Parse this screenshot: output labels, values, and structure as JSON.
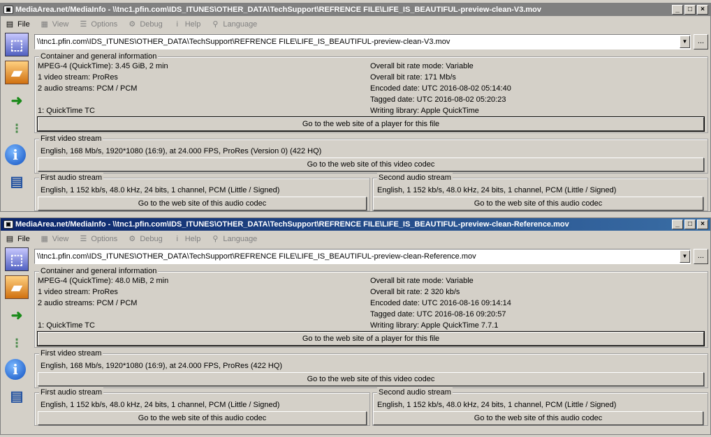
{
  "windows": [
    {
      "title": "MediaArea.net/MediaInfo - \\\\tnc1.pfin.com\\IDS_ITUNES\\OTHER_DATA\\TechSupport\\REFRENCE FILE\\LIFE_IS_BEAUTIFUL-preview-clean-V3.mov",
      "active": false,
      "path": "\\\\tnc1.pfin.com\\IDS_ITUNES\\OTHER_DATA\\TechSupport\\REFRENCE FILE\\LIFE_IS_BEAUTIFUL-preview-clean-V3.mov",
      "container": {
        "legend": "Container and general information",
        "left": [
          "MPEG-4 (QuickTime): 3.45 GiB, 2 min",
          "1 video stream: ProRes",
          "2 audio streams: PCM / PCM",
          "",
          "1: QuickTime TC"
        ],
        "right": [
          "Overall bit rate mode: Variable",
          "Overall bit rate: 171 Mb/s",
          "Encoded date: UTC 2016-08-02 05:14:40",
          "Tagged date: UTC 2016-08-02 05:20:23",
          "Writing library: Apple QuickTime"
        ],
        "button": "Go to the web site of a player for this file"
      },
      "video": {
        "legend": "First video stream",
        "text": "English, 168 Mb/s, 1920*1080 (16:9), at 24.000 FPS, ProRes (Version 0) (422 HQ)",
        "button": "Go to the web site of this video codec"
      },
      "audio1": {
        "legend": "First audio stream",
        "text": "English, 1 152 kb/s, 48.0 kHz, 24 bits, 1 channel, PCM (Little / Signed)",
        "button": "Go to the web site of this audio codec"
      },
      "audio2": {
        "legend": "Second audio stream",
        "text": "English, 1 152 kb/s, 48.0 kHz, 24 bits, 1 channel, PCM (Little / Signed)",
        "button": "Go to the web site of this audio codec"
      }
    },
    {
      "title": "MediaArea.net/MediaInfo - \\\\tnc1.pfin.com\\IDS_ITUNES\\OTHER_DATA\\TechSupport\\REFRENCE FILE\\LIFE_IS_BEAUTIFUL-preview-clean-Reference.mov",
      "active": true,
      "path": "\\\\tnc1.pfin.com\\IDS_ITUNES\\OTHER_DATA\\TechSupport\\REFRENCE FILE\\LIFE_IS_BEAUTIFUL-preview-clean-Reference.mov",
      "container": {
        "legend": "Container and general information",
        "left": [
          "MPEG-4 (QuickTime): 48.0 MiB, 2 min",
          "1 video stream: ProRes",
          "2 audio streams: PCM / PCM",
          "",
          "1: QuickTime TC"
        ],
        "right": [
          "Overall bit rate mode: Variable",
          "Overall bit rate: 2 320 kb/s",
          "Encoded date: UTC 2016-08-16 09:14:14",
          "Tagged date: UTC 2016-08-16 09:20:57",
          "Writing library: Apple QuickTime 7.7.1"
        ],
        "button": "Go to the web site of a player for this file"
      },
      "video": {
        "legend": "First video stream",
        "text": "English, 168 Mb/s, 1920*1080 (16:9), at 24.000 FPS, ProRes (422 HQ)",
        "button": "Go to the web site of this video codec"
      },
      "audio1": {
        "legend": "First audio stream",
        "text": "English, 1 152 kb/s, 48.0 kHz, 24 bits, 1 channel, PCM (Little / Signed)",
        "button": "Go to the web site of this audio codec"
      },
      "audio2": {
        "legend": "Second audio stream",
        "text": "English, 1 152 kb/s, 48.0 kHz, 24 bits, 1 channel, PCM (Little / Signed)",
        "button": "Go to the web site of this audio codec"
      }
    }
  ],
  "menu": [
    {
      "label": "File",
      "icon": "file-icon",
      "glyph": "▤"
    },
    {
      "label": "View",
      "icon": "view-icon",
      "glyph": "▦"
    },
    {
      "label": "Options",
      "icon": "options-icon",
      "glyph": "☰"
    },
    {
      "label": "Debug",
      "icon": "debug-icon",
      "glyph": "⚙"
    },
    {
      "label": "Help",
      "icon": "help-icon",
      "glyph": "i"
    },
    {
      "label": "Language",
      "icon": "language-icon",
      "glyph": "⚲"
    }
  ],
  "sidebar_icons": [
    "open-file-icon",
    "open-folder-icon",
    "export-icon",
    "preferences-icon",
    "about-icon",
    "sheet-view-icon"
  ],
  "title_buttons": [
    "_",
    "□",
    "×"
  ],
  "browse_label": "...",
  "colors": {
    "face": "#d4d0c8",
    "active_title": "#0a246a",
    "inactive_title": "#808080"
  }
}
